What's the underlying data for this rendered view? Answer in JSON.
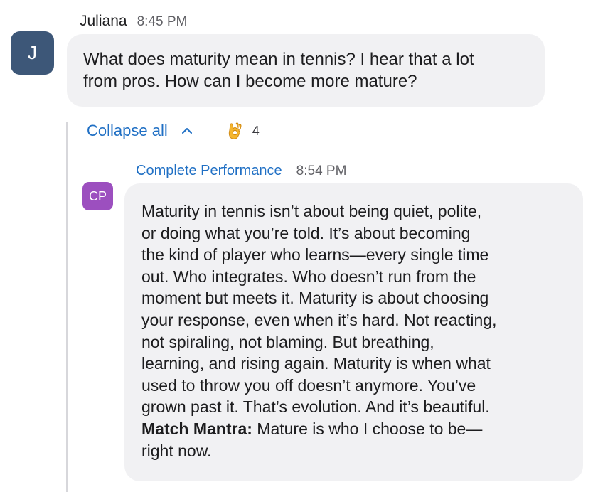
{
  "message1": {
    "avatar_initial": "J",
    "sender": "Juliana",
    "time": "8:45 PM",
    "text": "What does maturity mean in tennis? I hear that a lot\nfrom pros. How can I become more mature?"
  },
  "thread": {
    "collapse_label": "Collapse all",
    "reaction_icon": "ok-hand-emoji",
    "reaction_count": "4"
  },
  "reply": {
    "avatar_initials": "CP",
    "sender": "Complete Performance",
    "time": "8:54 PM",
    "body": "Maturity in tennis isn’t about being quiet, polite,\nor doing what you’re told. It’s about becoming\nthe kind of player who learns—every single time\nout. Who integrates. Who doesn’t run from the\nmoment but meets it. Maturity is about choosing\nyour response, even when it’s hard. Not reacting,\nnot spiraling, not blaming. But breathing,\nlearning, and rising again. Maturity is when what\nused to throw you off doesn’t anymore. You’ve\ngrown past it. That’s evolution. And it’s beautiful.",
    "mantra_label": "Match Mantra:",
    "mantra_text": " Mature is who I choose to be—\nright now."
  },
  "colors": {
    "avatar_j": "#3d5778",
    "avatar_cp": "#9c4fbf",
    "link_blue": "#1f6fc4",
    "bubble_bg": "#f1f1f3"
  }
}
